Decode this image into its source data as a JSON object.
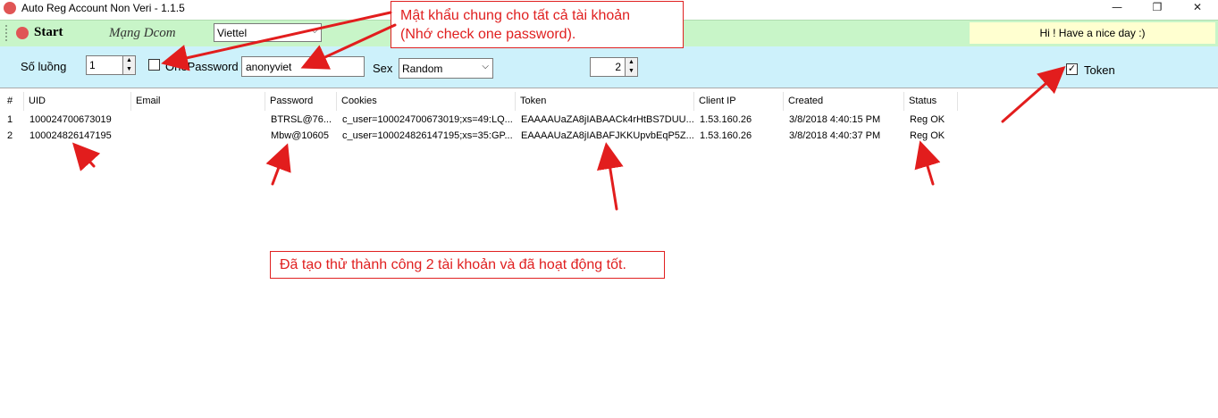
{
  "window": {
    "title": "Auto Reg Account Non Veri  -  1.1.5",
    "minimize": "—",
    "maximize": "❐",
    "close": "✕"
  },
  "toolbar": {
    "start_label": "Start",
    "network_label": "Mạng Dcom",
    "network_value": "Viettel",
    "greeting": "Hi  ! Have a nice day :)"
  },
  "options": {
    "threads_label": "Số luồng",
    "threads_value": "1",
    "onepassword_label": "OnePassword",
    "onepassword_checked": false,
    "password_value": "anonyviet",
    "sex_label": "Sex",
    "sex_value": "Random",
    "count_value": "2",
    "token_label": "Token",
    "token_checked": true
  },
  "table": {
    "columns": [
      "#",
      "UID",
      "Email",
      "Password",
      "Cookies",
      "Token",
      "Client IP",
      "Created",
      "Status"
    ],
    "rows": [
      [
        "1",
        "100024700673019",
        "",
        "BTRSL@76...",
        "c_user=100024700673019;xs=49:LQ...",
        "EAAAAUaZA8jIABAACk4rHtBS7DUU...",
        "1.53.160.26",
        "3/8/2018 4:40:15 PM",
        "Reg OK"
      ],
      [
        "2",
        "100024826147195",
        "",
        "Mbw@10605",
        "c_user=100024826147195;xs=35:GP...",
        "EAAAAUaZA8jIABAFJKKUpvbEqP5Z...",
        "1.53.160.26",
        "3/8/2018 4:40:37 PM",
        "Reg OK"
      ]
    ]
  },
  "annotations": {
    "top_line1": "Mật khẩu chung cho tất cả tài khoản",
    "top_line2": "(Nhớ check one password).",
    "bottom": "Đã tạo thử thành công 2 tài khoản và đã hoạt động tốt."
  },
  "colors": {
    "toolbar_bg": "#c8f5c8",
    "options_bg": "#cdf1fb",
    "greeting_bg": "#ffffd0",
    "annotation_red": "#e02020"
  }
}
